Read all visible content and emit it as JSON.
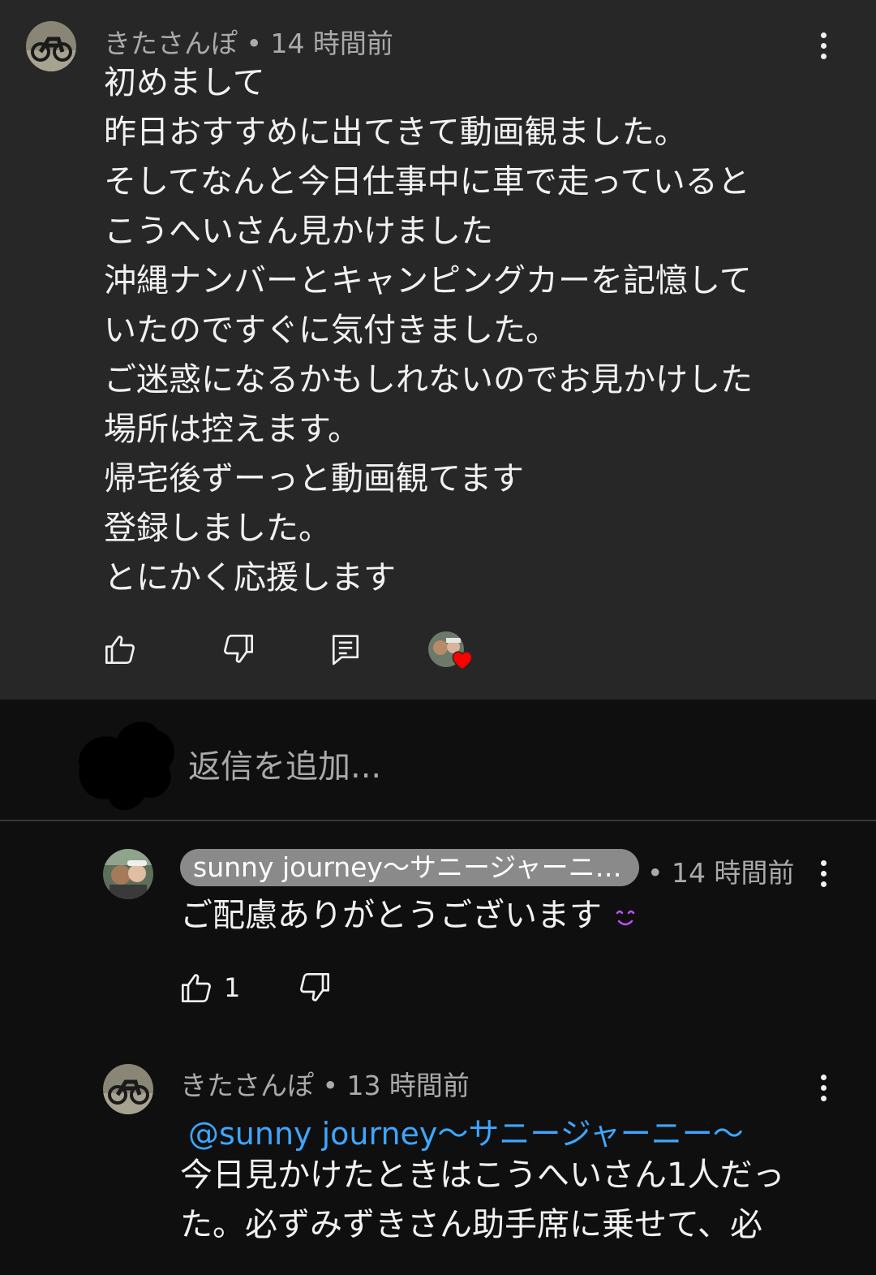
{
  "comment": {
    "author": "きたさんぽ",
    "time": "14 時間前",
    "meta": "きたさんぽ • 14 時間前",
    "body": "初めまして\n昨日おすすめに出てきて動画観ました。\nそしてなんと今日仕事中に車で走っていると\nこうへいさん見かけました\n沖縄ナンバーとキャンピングカーを記憶して\nいたのですぐに気付きました。\nご迷惑になるかもしれないのでお見かけした\n場所は控えます。\n帰宅後ずーっと動画観てます\n登録しました。\nとにかく応援します",
    "hearted": true
  },
  "reply_input": {
    "placeholder": "返信を追加..."
  },
  "replies": [
    {
      "author": "sunny journey〜サニージャーニ…",
      "time": "• 14 時間前",
      "body": "ご配慮ありがとうございます",
      "emoji": "☺",
      "likes": "1"
    },
    {
      "meta": "きたさんぽ • 13 時間前",
      "mention": "@sunny journey〜サニージャーニー〜",
      "body": "今日見かけたときはこうへいさん1人だっ\nた。必ずみずきさん助手席に乗せて、必"
    }
  ],
  "colors": {
    "top_comment_bg": "#272727",
    "page_bg": "#0f0f0f",
    "mention": "#3ea6ff",
    "heart": "#ff0000",
    "emoji": "#c050ff"
  }
}
